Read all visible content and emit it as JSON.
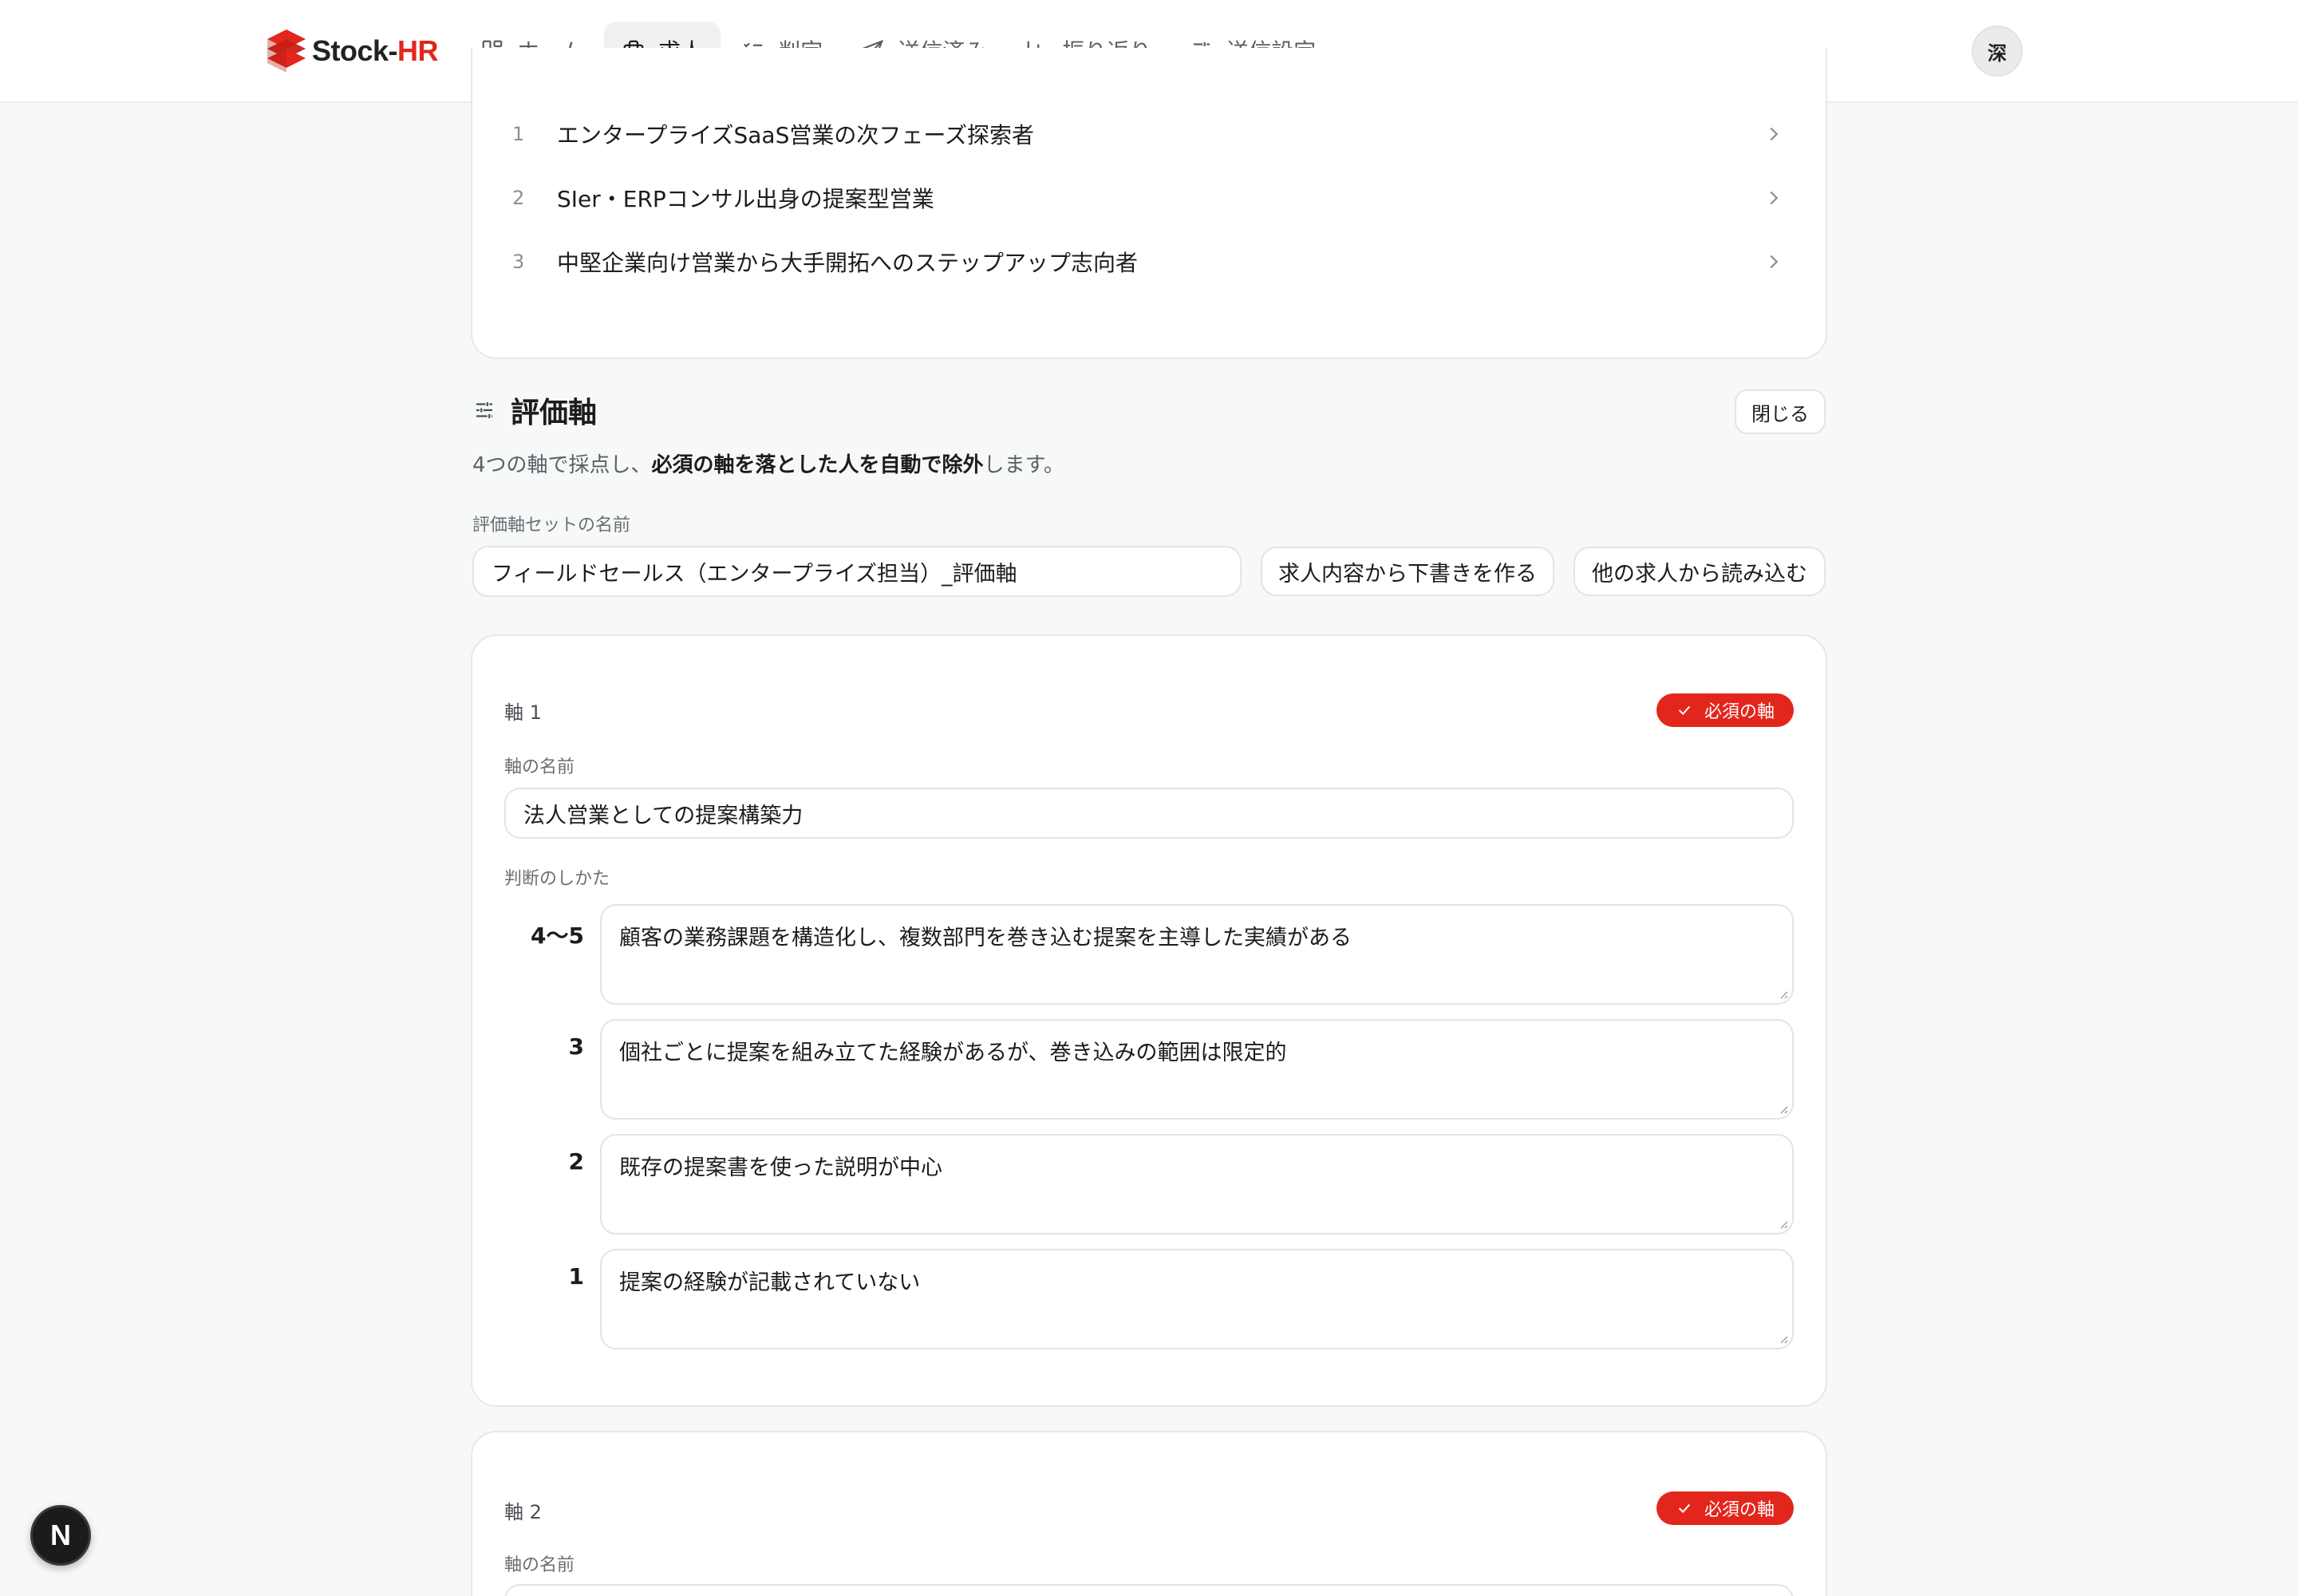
{
  "brand": {
    "name_part1": "Stock-",
    "name_part2": "HR",
    "brand_color": "#e2261c"
  },
  "nav": {
    "items": [
      {
        "label": "ホーム",
        "icon": "grid-icon"
      },
      {
        "label": "求人",
        "icon": "briefcase-icon",
        "active": true
      },
      {
        "label": "判定",
        "icon": "checklist-icon"
      },
      {
        "label": "送信済み",
        "icon": "send-icon"
      },
      {
        "label": "振り返り",
        "icon": "bar-chart-icon"
      },
      {
        "label": "送信設定",
        "icon": "sliders-icon"
      }
    ],
    "avatar": "深"
  },
  "personas": [
    {
      "num": "1",
      "text": "エンタープライズSaaS営業の次フェーズ探索者"
    },
    {
      "num": "2",
      "text": "SIer・ERPコンサル出身の提案型営業"
    },
    {
      "num": "3",
      "text": "中堅企業向け営業から大手開拓へのステップアップ志向者"
    }
  ],
  "eval": {
    "title": "評価軸",
    "close_label": "閉じる",
    "desc_prefix": "4つの軸で採点し、",
    "desc_bold": "必須の軸を落とした人を自動で除外",
    "desc_suffix": "します。",
    "set_name_label": "評価軸セットの名前",
    "set_name_value": "フィールドセールス（エンタープライズ担当）_評価軸",
    "draft_button": "求人内容から下書きを作る",
    "import_button": "他の求人から読み込む"
  },
  "axes": [
    {
      "label": "軸 1",
      "badge": "必須の軸",
      "name_label": "軸の名前",
      "name_value": "法人営業としての提案構築力",
      "criteria_label": "判断のしかた",
      "criteria": [
        {
          "score": "4〜5",
          "text": "顧客の業務課題を構造化し、複数部門を巻き込む提案を主導した実績がある"
        },
        {
          "score": "3",
          "text": "個社ごとに提案を組み立てた経験があるが、巻き込みの範囲は限定的"
        },
        {
          "score": "2",
          "text": "既存の提案書を使った説明が中心"
        },
        {
          "score": "1",
          "text": "提案の経験が記載されていない"
        }
      ]
    },
    {
      "label": "軸 2",
      "badge": "必須の軸",
      "name_label": "軸の名前"
    }
  ],
  "fab": {
    "label": "N"
  }
}
